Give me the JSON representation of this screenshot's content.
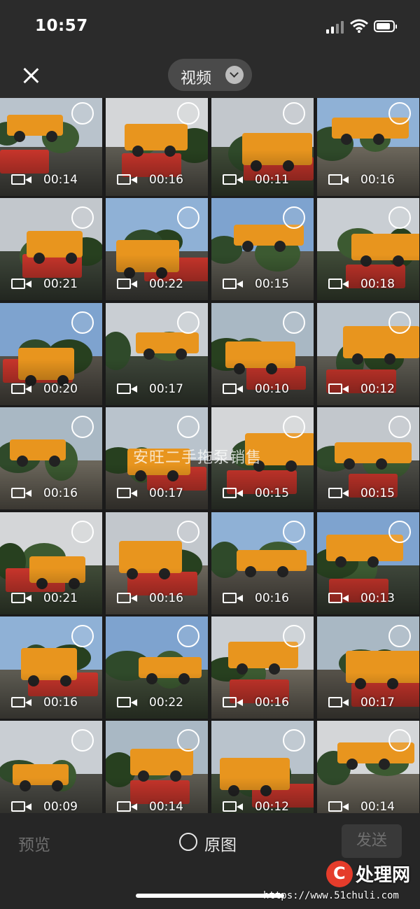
{
  "status_bar": {
    "time": "10:57",
    "battery_level": 0.85
  },
  "header": {
    "album_title": "视频",
    "close_icon": "close-icon",
    "dropdown_icon": "chevron-down-icon"
  },
  "watermark": "安旺二手拖泵销售",
  "videos": [
    "00:14",
    "00:16",
    "00:11",
    "00:16",
    "00:21",
    "00:22",
    "00:15",
    "00:18",
    "00:20",
    "00:17",
    "00:10",
    "00:12",
    "00:16",
    "00:17",
    "00:15",
    "00:15",
    "00:21",
    "00:16",
    "00:16",
    "00:13",
    "00:16",
    "00:22",
    "00:16",
    "00:17",
    "00:09",
    "00:14",
    "00:12",
    "00:14"
  ],
  "bottom_bar": {
    "preview": "预览",
    "original": "原图",
    "send": "发送"
  },
  "site_watermark": {
    "name": "处理网",
    "url": "https://www.51chuli.com"
  },
  "colors": {
    "background": "#1b1b1b",
    "bar": "#262626",
    "pump_orange": "#e8951e",
    "truck_red": "#c7352b"
  }
}
